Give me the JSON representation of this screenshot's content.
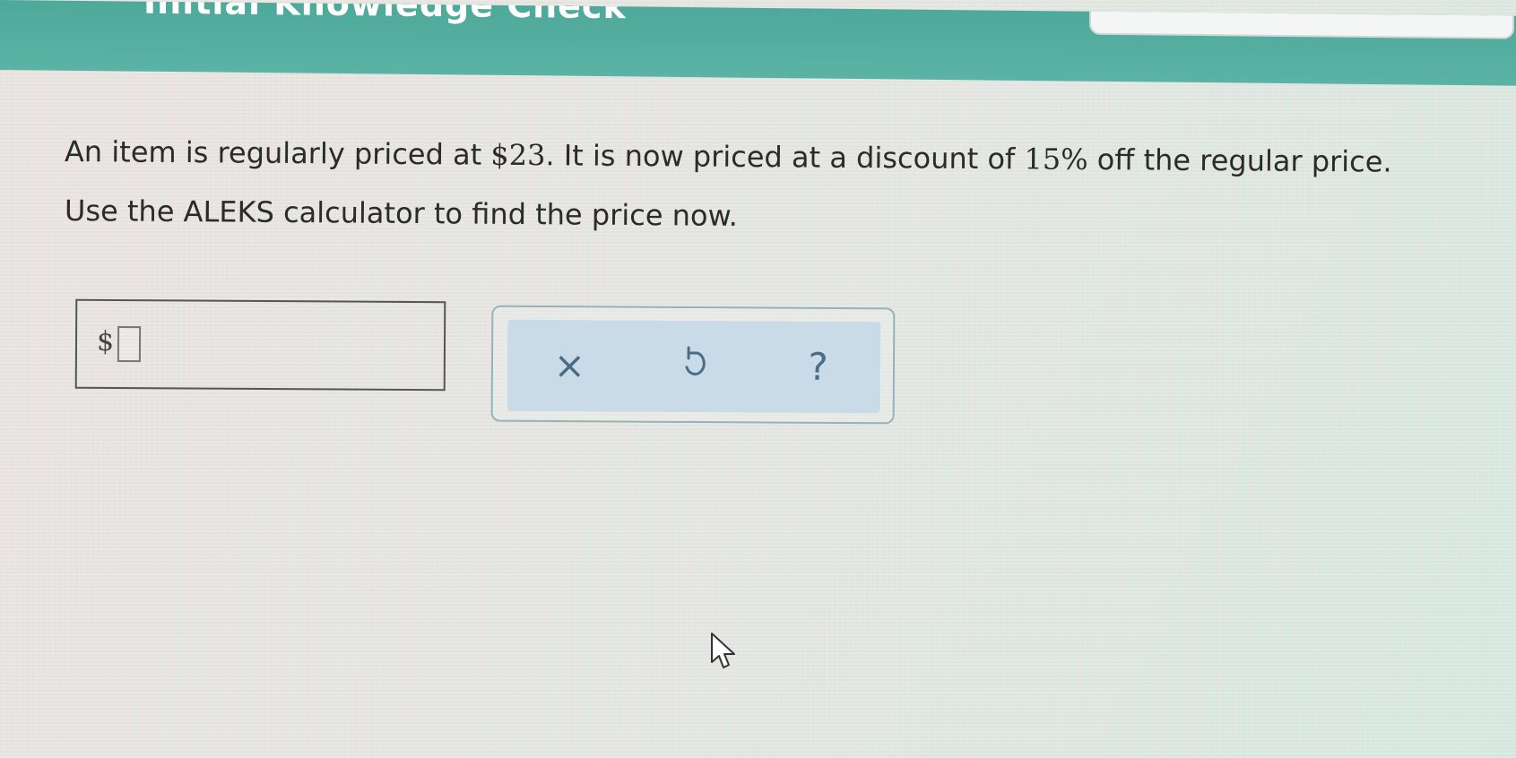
{
  "header": {
    "title": "Initial Knowledge Check"
  },
  "question": {
    "line1_pre": "An item is regularly priced at ",
    "price": "$23",
    "line1_mid": ". It is now priced at a discount of ",
    "discount": "15%",
    "line1_post": " off the regular price.",
    "line2": "Use the ALEKS calculator to find the price now."
  },
  "answer": {
    "currency_symbol": "$",
    "value": ""
  },
  "tools": {
    "clear_symbol": "×",
    "help_symbol": "?"
  },
  "icons": {
    "clear": "close-icon",
    "undo": "undo-icon",
    "help": "help-icon",
    "cursor": "mouse-pointer-icon"
  }
}
